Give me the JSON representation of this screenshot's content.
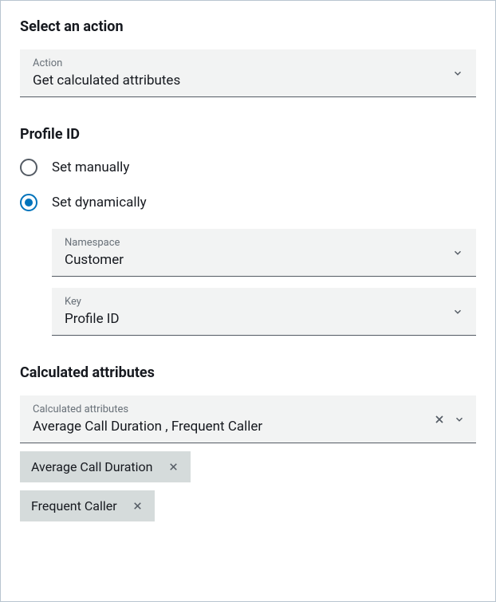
{
  "action_section": {
    "title": "Select an action",
    "dropdown_label": "Action",
    "dropdown_value": "Get calculated attributes"
  },
  "profile_section": {
    "title": "Profile ID",
    "radio_options": {
      "manual": "Set manually",
      "dynamic": "Set dynamically"
    },
    "selected": "dynamic",
    "namespace": {
      "label": "Namespace",
      "value": "Customer"
    },
    "key": {
      "label": "Key",
      "value": "Profile ID"
    }
  },
  "calculated_section": {
    "title": "Calculated attributes",
    "dropdown_label": "Calculated attributes",
    "dropdown_value": "Average Call Duration , Frequent Caller",
    "chips": [
      "Average Call Duration",
      "Frequent Caller"
    ]
  }
}
